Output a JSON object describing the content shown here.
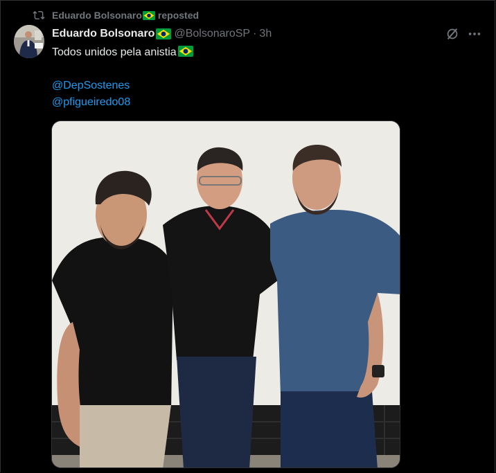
{
  "repost": {
    "user": "Eduardo Bolsonaro",
    "label": "reposted",
    "icon": "repost-icon"
  },
  "tweet": {
    "author_name": "Eduardo Bolsonaro",
    "handle": "@BolsonaroSP",
    "separator": "·",
    "time": "3h",
    "text": "Todos unidos pela anistia",
    "mentions": [
      "@DepSostenes",
      "@pfigueiredo08"
    ],
    "emoji": "brazil-flag-emoji"
  },
  "colors": {
    "background": "#000000",
    "text": "#e7e9ea",
    "secondary": "#71767b",
    "link": "#1d9bf0"
  },
  "icons": {
    "grok": "grok-icon",
    "more": "more-icon"
  }
}
